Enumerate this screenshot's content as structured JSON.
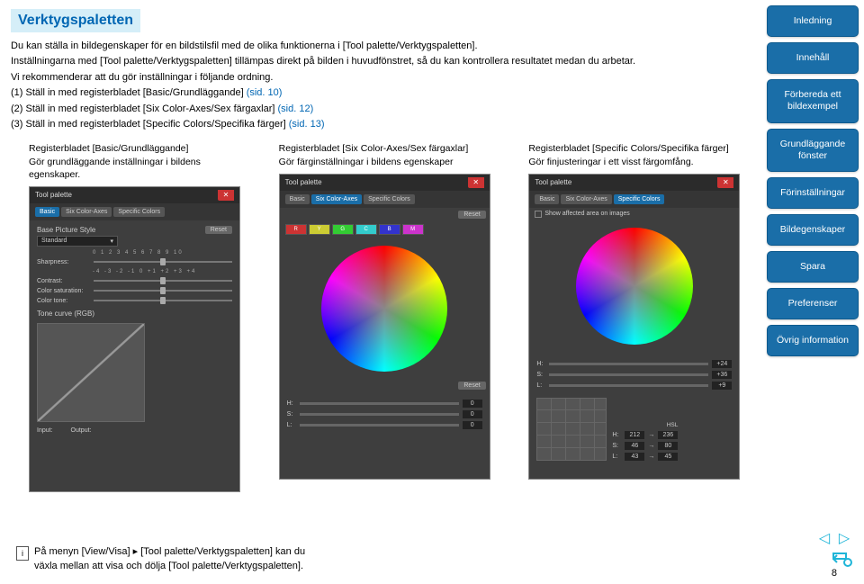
{
  "title": "Verktygspaletten",
  "intro": [
    "Du kan ställa in bildegenskaper för en bildstilsfil med de olika funktionerna i [Tool palette/Verktygspaletten].",
    "Inställningarna med [Tool palette/Verktygspaletten] tillämpas direkt på bilden i huvudfönstret, så du kan kontrollera resultatet medan du arbetar.",
    "Vi rekommenderar att du gör inställningar i följande ordning."
  ],
  "steps": [
    {
      "text": "(1) Ställ in med registerbladet [Basic/Grundläggande] ",
      "ref": "(sid. 10)"
    },
    {
      "text": "(2) Ställ in med registerbladet [Six Color-Axes/Sex färgaxlar] ",
      "ref": "(sid. 12)"
    },
    {
      "text": "(3) Ställ in med registerbladet [Specific Colors/Specifika färger] ",
      "ref": "(sid. 13)"
    }
  ],
  "cols": [
    {
      "title": "Registerbladet [Basic/Grundläggande]",
      "desc": "Gör grundläggande inställningar i bildens egenskaper."
    },
    {
      "title": "Registerbladet [Six Color-Axes/Sex färgaxlar]",
      "desc": "Gör färginställningar i bildens egenskaper"
    },
    {
      "title": "Registerbladet [Specific Colors/Specifika färger]",
      "desc": "Gör finjusteringar i ett visst färgomfång."
    }
  ],
  "palette": {
    "header": "Tool palette",
    "tabs": [
      "Basic",
      "Six Color-Axes",
      "Specific Colors"
    ],
    "basic": {
      "base_label": "Base Picture Style",
      "base_value": "Standard",
      "reset": "Reset",
      "sharpness": "Sharpness:",
      "contrast": "Contrast:",
      "saturation": "Color saturation:",
      "colortone": "Color tone:",
      "tonecurve": "Tone curve (RGB)",
      "input": "Input:",
      "output": "Output:",
      "scale_0_10": "0 1 2 3 4 5 6 7 8 9 10",
      "scale_neg": "-4 -3 -2 -1 0 +1 +2 +3 +4"
    },
    "six": {
      "chips": [
        "R",
        "Y",
        "G",
        "C",
        "B",
        "M"
      ],
      "h": "H:",
      "s": "S:",
      "l": "L:",
      "val0": "0"
    },
    "specific": {
      "show": "Show affected area on images",
      "hsl": "HSL",
      "hv": "+24",
      "sv": "+36",
      "lv": "+9",
      "h2v": "212",
      "s2v": "46",
      "l2v": "43",
      "r1": "236",
      "r2": "80",
      "r3": "45"
    }
  },
  "footer": {
    "text1": "På menyn [View/Visa] ▸ [Tool palette/Verktygspaletten] kan du",
    "text2": "växla mellan att visa och dölja [Tool palette/Verktygspaletten]."
  },
  "sidebar": [
    "Inledning",
    "Innehåll",
    "Förbereda ett bildexempel",
    "Grundläggande fönster",
    "Förinställningar",
    "Bildegenskaper",
    "Spara",
    "Preferenser",
    "Övrig information"
  ],
  "page": "8"
}
